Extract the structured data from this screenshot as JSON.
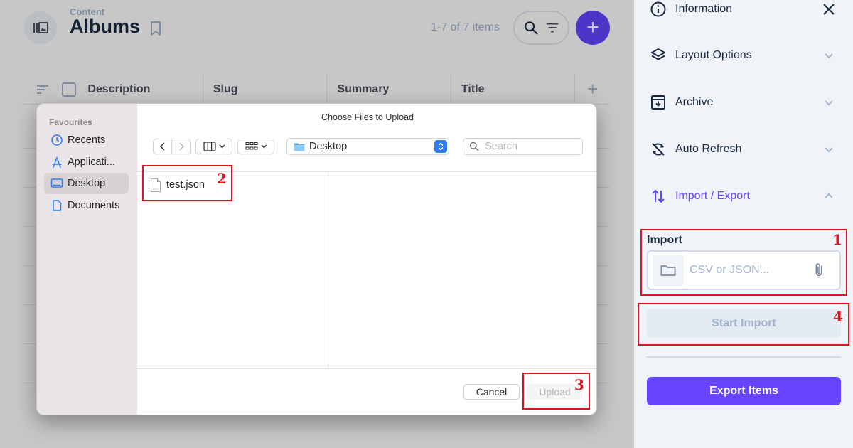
{
  "header": {
    "breadcrumb": "Content",
    "title": "Albums",
    "item_count": "1-7 of 7 items"
  },
  "table": {
    "columns": [
      "Description",
      "Slug",
      "Summary",
      "Title"
    ]
  },
  "sidebar": {
    "items": [
      {
        "label": "Information",
        "icon": "info-icon"
      },
      {
        "label": "Layout Options",
        "icon": "layers-icon"
      },
      {
        "label": "Archive",
        "icon": "archive-icon"
      },
      {
        "label": "Auto Refresh",
        "icon": "sync-disabled-icon"
      },
      {
        "label": "Import / Export",
        "icon": "import-export-icon"
      }
    ],
    "import": {
      "label": "Import",
      "placeholder": "CSV or JSON...",
      "start_label": "Start Import"
    },
    "export_label": "Export Items"
  },
  "dialog": {
    "title": "Choose Files to Upload",
    "favourites_title": "Favourites",
    "favourites": [
      "Recents",
      "Applicati...",
      "Desktop",
      "Documents"
    ],
    "selected_favourite": "Desktop",
    "location": "Desktop",
    "search_placeholder": "Search",
    "files": [
      "test.json"
    ],
    "cancel_label": "Cancel",
    "upload_label": "Upload"
  },
  "annotations": [
    "1",
    "2",
    "3",
    "4"
  ],
  "colors": {
    "accent": "#6644ff",
    "annotation": "#e0141e",
    "macos_blue": "#2f7cf6"
  }
}
